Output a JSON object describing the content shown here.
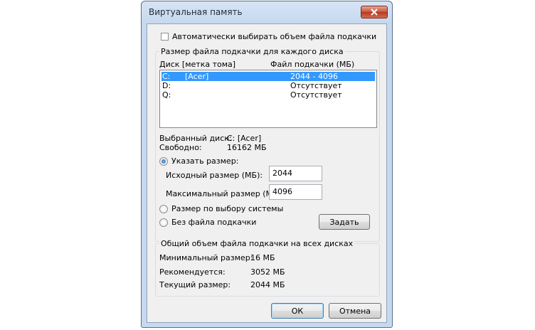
{
  "window": {
    "title": "Виртуальная память",
    "close_icon": "close-icon"
  },
  "auto_manage": {
    "label": "Автоматически выбирать объем файла подкачки",
    "checked": false
  },
  "per_drive": {
    "group_label": "Размер файла подкачки для каждого диска",
    "col_drive": "Диск [метка тома]",
    "col_size": "Файл подкачки (МБ)",
    "drives": [
      {
        "letter": "C:",
        "label": "[Acer]",
        "size": "2044 - 4096",
        "selected": true
      },
      {
        "letter": "D:",
        "label": "",
        "size": "Отсутствует",
        "selected": false
      },
      {
        "letter": "Q:",
        "label": "",
        "size": "Отсутствует",
        "selected": false
      }
    ]
  },
  "selected": {
    "disk_label": "Выбранный диск:",
    "disk_value": "C:  [Acer]",
    "free_label": "Свободно:",
    "free_value": "16162 МБ"
  },
  "options": {
    "custom_label": "Указать размер:",
    "initial_label": "Исходный размер (МБ):",
    "initial_value": "2044",
    "max_label": "Максимальный размер (МБ):",
    "max_value": "4096",
    "system_label": "Размер по выбору системы",
    "none_label": "Без файла подкачки",
    "set_button": "Задать",
    "selected_option": "custom"
  },
  "totals": {
    "group_label": "Общий объем файла подкачки на всех дисках",
    "min_label": "Минимальный размер:",
    "min_value": "16 МБ",
    "rec_label": "Рекомендуется:",
    "rec_value": "3052 МБ",
    "cur_label": "Текущий размер:",
    "cur_value": "2044 МБ"
  },
  "buttons": {
    "ok": "ОК",
    "cancel": "Отмена"
  }
}
